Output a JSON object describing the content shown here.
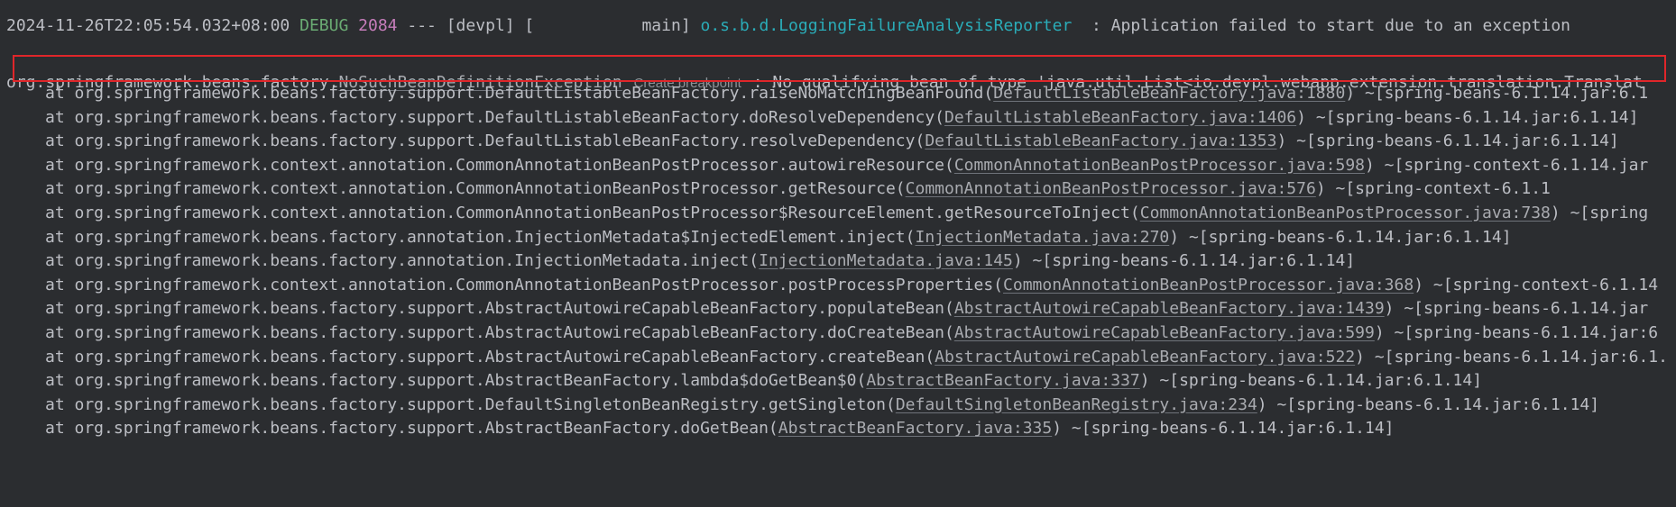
{
  "header": {
    "timestamp": "2024-11-26T22:05:54.032+08:00",
    "level": "DEBUG",
    "pid": "2084",
    "sep": "---",
    "app": "[devpl]",
    "thread": "[           main]",
    "logger": "o.s.b.d.LoggingFailureAnalysisReporter",
    "message": "  : Application failed to start due to an exception"
  },
  "exception": {
    "prefix": "org.springframework.beans.factory.",
    "class_name": "NoSuchBeanDefinitionException",
    "breakpoint_hint": "Create breakpoint",
    "message": ": No qualifying bean of type 'java.util.List<io.devpl.webapp.extension.translation.Translat"
  },
  "frames": [
    {
      "pre": "at org.springframework.beans.factory.support.DefaultListableBeanFactory.raiseNoMatchingBeanFound(",
      "link": "DefaultListableBeanFactory.java:1880",
      "post": ") ~[spring-beans-6.1.14.jar:6.1"
    },
    {
      "pre": "at org.springframework.beans.factory.support.DefaultListableBeanFactory.doResolveDependency(",
      "link": "DefaultListableBeanFactory.java:1406",
      "post": ") ~[spring-beans-6.1.14.jar:6.1.14]"
    },
    {
      "pre": "at org.springframework.beans.factory.support.DefaultListableBeanFactory.resolveDependency(",
      "link": "DefaultListableBeanFactory.java:1353",
      "post": ") ~[spring-beans-6.1.14.jar:6.1.14]"
    },
    {
      "pre": "at org.springframework.context.annotation.CommonAnnotationBeanPostProcessor.autowireResource(",
      "link": "CommonAnnotationBeanPostProcessor.java:598",
      "post": ") ~[spring-context-6.1.14.jar"
    },
    {
      "pre": "at org.springframework.context.annotation.CommonAnnotationBeanPostProcessor.getResource(",
      "link": "CommonAnnotationBeanPostProcessor.java:576",
      "post": ") ~[spring-context-6.1.1"
    },
    {
      "pre": "at org.springframework.context.annotation.CommonAnnotationBeanPostProcessor$ResourceElement.getResourceToInject(",
      "link": "CommonAnnotationBeanPostProcessor.java:738",
      "post": ") ~[spring"
    },
    {
      "pre": "at org.springframework.beans.factory.annotation.InjectionMetadata$InjectedElement.inject(",
      "link": "InjectionMetadata.java:270",
      "post": ") ~[spring-beans-6.1.14.jar:6.1.14]"
    },
    {
      "pre": "at org.springframework.beans.factory.annotation.InjectionMetadata.inject(",
      "link": "InjectionMetadata.java:145",
      "post": ") ~[spring-beans-6.1.14.jar:6.1.14]"
    },
    {
      "pre": "at org.springframework.context.annotation.CommonAnnotationBeanPostProcessor.postProcessProperties(",
      "link": "CommonAnnotationBeanPostProcessor.java:368",
      "post": ") ~[spring-context-6.1.14"
    },
    {
      "pre": "at org.springframework.beans.factory.support.AbstractAutowireCapableBeanFactory.populateBean(",
      "link": "AbstractAutowireCapableBeanFactory.java:1439",
      "post": ") ~[spring-beans-6.1.14.jar"
    },
    {
      "pre": "at org.springframework.beans.factory.support.AbstractAutowireCapableBeanFactory.doCreateBean(",
      "link": "AbstractAutowireCapableBeanFactory.java:599",
      "post": ") ~[spring-beans-6.1.14.jar:6"
    },
    {
      "pre": "at org.springframework.beans.factory.support.AbstractAutowireCapableBeanFactory.createBean(",
      "link": "AbstractAutowireCapableBeanFactory.java:522",
      "post": ") ~[spring-beans-6.1.14.jar:6.1."
    },
    {
      "pre": "at org.springframework.beans.factory.support.AbstractBeanFactory.lambda$doGetBean$0(",
      "link": "AbstractBeanFactory.java:337",
      "post": ") ~[spring-beans-6.1.14.jar:6.1.14]"
    },
    {
      "pre": "at org.springframework.beans.factory.support.DefaultSingletonBeanRegistry.getSingleton(",
      "link": "DefaultSingletonBeanRegistry.java:234",
      "post": ") ~[spring-beans-6.1.14.jar:6.1.14]"
    },
    {
      "pre": "at org.springframework.beans.factory.support.AbstractBeanFactory.doGetBean(",
      "link": "AbstractBeanFactory.java:335",
      "post": ") ~[spring-beans-6.1.14.jar:6.1.14]"
    }
  ]
}
